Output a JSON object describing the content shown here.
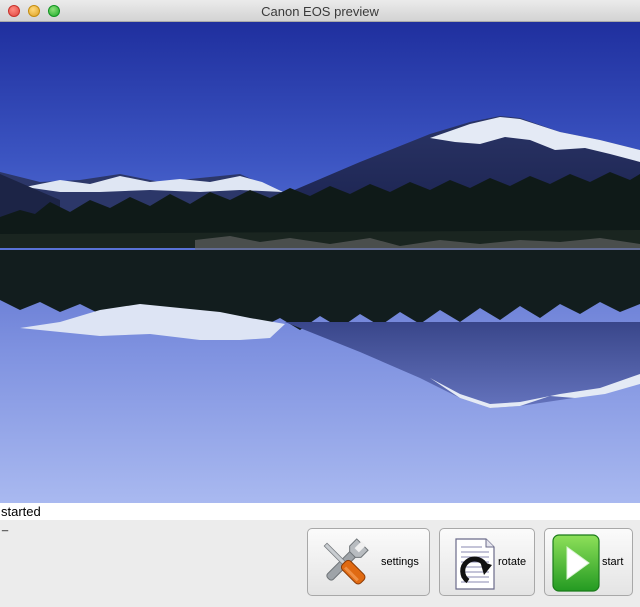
{
  "window": {
    "title": "Canon EOS preview"
  },
  "status": {
    "text": "started",
    "caret": "_"
  },
  "buttons": {
    "settings": {
      "label": "settings",
      "icon": "wrench-screwdriver-icon"
    },
    "rotate": {
      "label": "rotate",
      "icon": "rotate-document-icon"
    },
    "start": {
      "label": "start",
      "icon": "play-icon"
    }
  },
  "preview": {
    "content": "camera-live-view-image"
  },
  "colors": {
    "play_green": "#3db33a",
    "window_bg": "#ececec"
  }
}
